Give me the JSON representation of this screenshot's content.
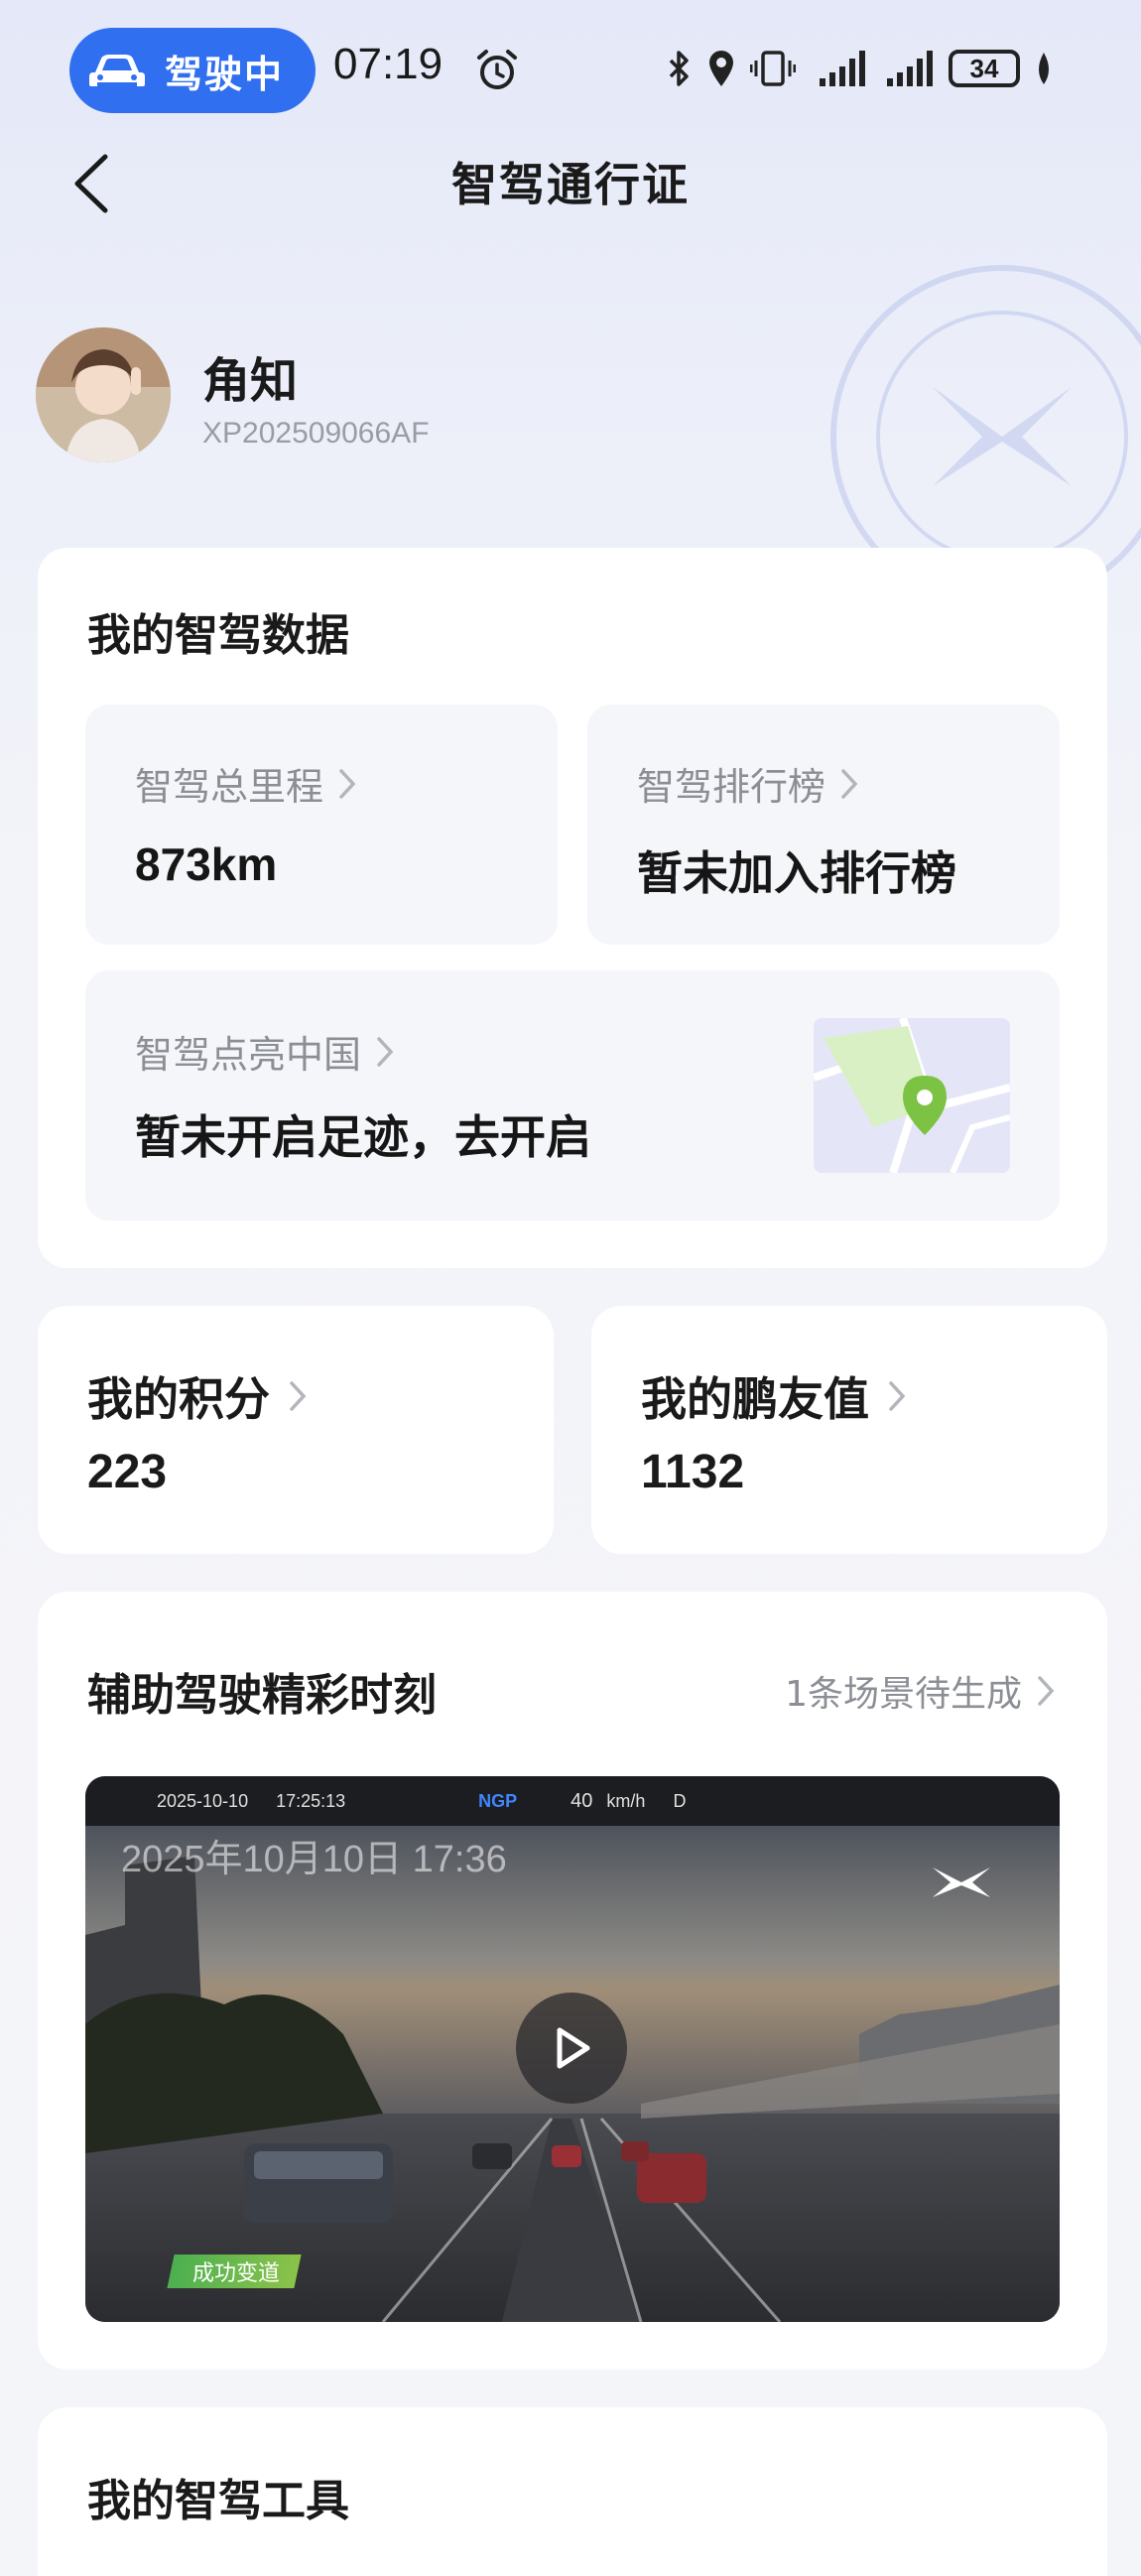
{
  "status_bar": {
    "driving_label": "驾驶中",
    "time": "07:19",
    "battery": "34"
  },
  "header": {
    "title": "智驾通行证"
  },
  "profile": {
    "name": "角知",
    "id": "XP202509066AF"
  },
  "smart_driving_data": {
    "title": "我的智驾数据",
    "total_mileage": {
      "label": "智驾总里程",
      "value": "873km"
    },
    "leaderboard": {
      "label": "智驾排行榜",
      "value": "暂未加入排行榜"
    },
    "light_up_china": {
      "label": "智驾点亮中国",
      "value": "暂未开启足迹，去开启"
    }
  },
  "points": {
    "label": "我的积分",
    "value": "223"
  },
  "peng_friend": {
    "label": "我的鹏友值",
    "value": "1132"
  },
  "highlights": {
    "title": "辅助驾驶精彩时刻",
    "pending": "1条场景待生成",
    "video": {
      "hud_date": "2025-10-10",
      "hud_time": "17:25:13",
      "hud_mode": "NGP",
      "hud_speed": "40",
      "hud_unit": "km/h",
      "hud_gear": "D",
      "overlay_date": "2025年10月10日 17:36",
      "tag": "成功变道"
    }
  },
  "tools": {
    "title": "我的智驾工具"
  },
  "colors": {
    "accent": "#2f6ff0",
    "map_pin": "#7cc243",
    "tag_green": "#4caf50"
  }
}
